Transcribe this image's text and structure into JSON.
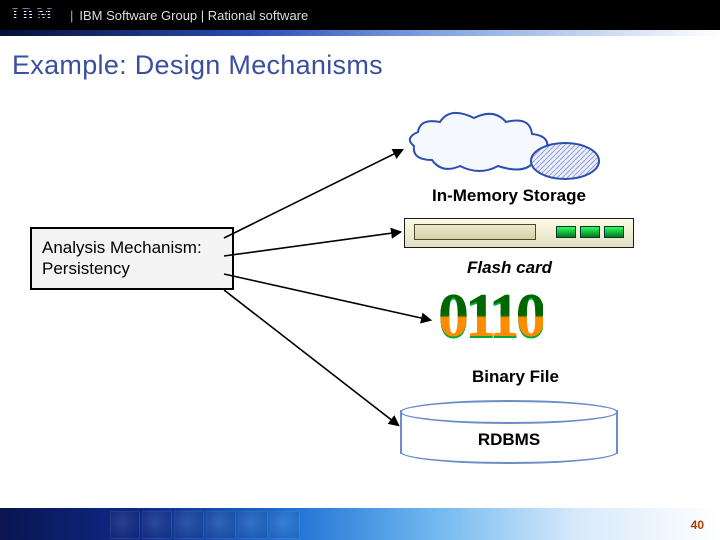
{
  "header": {
    "logo": "IBM",
    "group": "IBM Software Group",
    "product": "Rational software"
  },
  "title": "Example: Design Mechanisms",
  "analysis_box": "Analysis Mechanism: Persistency",
  "mechanisms": {
    "in_memory": "In-Memory Storage",
    "flash": "Flash card",
    "binary_glyph": "0110",
    "binary": "Binary File",
    "rdbms": "RDBMS"
  },
  "page_number": "40"
}
